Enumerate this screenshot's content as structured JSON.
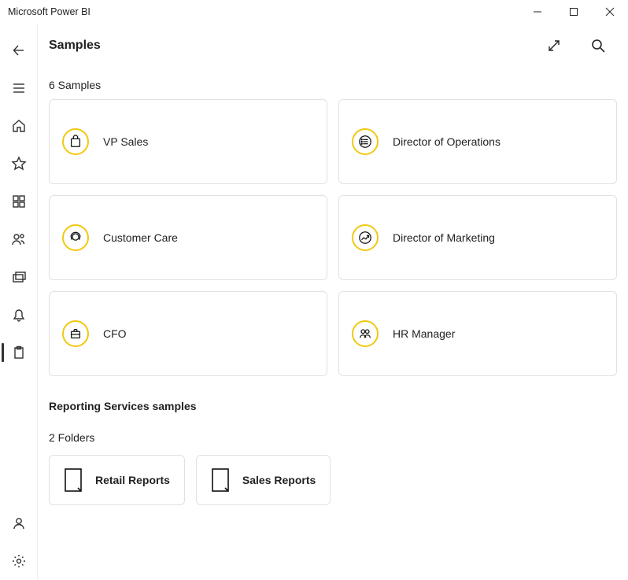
{
  "window_title": "Microsoft Power BI",
  "page_title": "Samples",
  "samples_count_label": "6 Samples",
  "samples": [
    {
      "label": "VP Sales"
    },
    {
      "label": "Director of Operations"
    },
    {
      "label": "Customer Care"
    },
    {
      "label": "Director of Marketing"
    },
    {
      "label": "CFO"
    },
    {
      "label": "HR Manager"
    }
  ],
  "section_heading": "Reporting Services samples",
  "folders_count_label": "2 Folders",
  "folders": [
    {
      "label": "Retail Reports"
    },
    {
      "label": "Sales Reports"
    }
  ]
}
